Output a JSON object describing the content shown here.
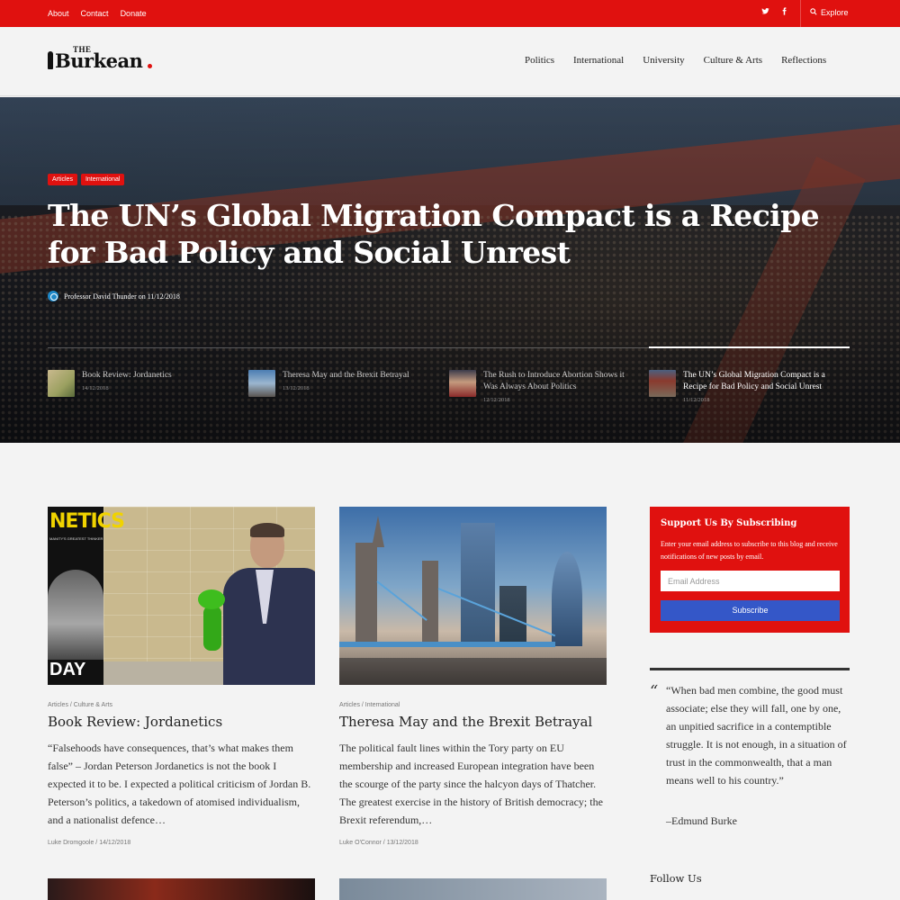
{
  "topbar": {
    "links": [
      "About",
      "Contact",
      "Donate"
    ],
    "social": [
      "twitter-icon",
      "facebook-icon"
    ],
    "explore_label": "Explore"
  },
  "header": {
    "logo_small": "THE",
    "logo_name": "Burkean",
    "logo_dot_color": "#e0110f",
    "nav": [
      "Politics",
      "International",
      "University",
      "Culture & Arts",
      "Reflections"
    ]
  },
  "hero": {
    "tags": [
      "Articles",
      "International"
    ],
    "title": "The UN’s Global Migration Compact is a Recipe for Bad Policy and Social Unrest",
    "byline": "Professor David Thunder on 11/12/2018",
    "slides": [
      {
        "title": "Book Review: Jordanetics",
        "date": "14/12/2018"
      },
      {
        "title": "Theresa May and the Brexit Betrayal",
        "date": "13/12/2018"
      },
      {
        "title": "The Rush to Introduce Abortion Shows it Was Always About Politics",
        "date": "12/12/2018"
      },
      {
        "title": "The UN’s Global Migration Compact is a Recipe for Bad Policy and Social Unrest",
        "date": "11/12/2018"
      }
    ]
  },
  "cards": [
    {
      "category": "Articles  /  Culture & Arts",
      "title": "Book Review: Jordanetics",
      "excerpt": "“Falsehoods have consequences, that’s what makes them false” – Jordan Peterson Jordanetics is not the book I expected it to be. I expected a political criticism of Jordan B. Peterson’s politics, a takedown of atomised individualism, and a nationalist defence…",
      "meta": "Luke Dromgoole  /  14/12/2018",
      "image_text_title": "NETICS",
      "image_text_sub": "MANITY'S GREATEST THINKER",
      "image_text_bottom": "DAY"
    },
    {
      "category": "Articles  /  International",
      "title": "Theresa May and the Brexit Betrayal",
      "excerpt": "The political fault lines within the Tory party on EU membership and increased European integration have been the scourge of the party since the halcyon days of Thatcher.  The greatest exercise in the history of British democracy; the Brexit referendum,…",
      "meta": "Luke O'Connor  /  13/12/2018"
    }
  ],
  "subscribe": {
    "heading": "Support Us By Subscribing",
    "text": "Enter your email address to subscribe to this blog and receive notifications of new posts by email.",
    "placeholder": "Email Address",
    "button": "Subscribe",
    "bg_color": "#e0110f",
    "button_color": "#3457c8"
  },
  "quote": {
    "mark": "“",
    "text": "“When bad men combine, the good must associate; else they will fall, one by one, an unpitied sacrifice in a contemptible struggle. It is not enough, in a situation of trust in the commonwealth, that a man means well to his country.”",
    "author": "–Edmund Burke"
  },
  "follow": {
    "heading": "Follow Us"
  }
}
